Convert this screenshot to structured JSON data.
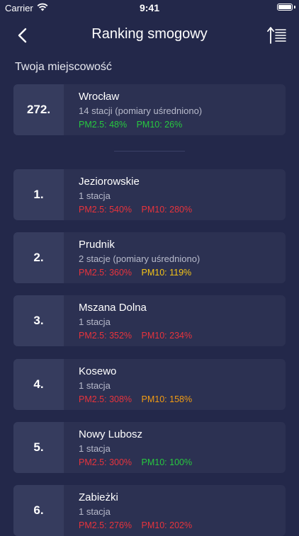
{
  "status": {
    "carrier": "Carrier",
    "time": "9:41"
  },
  "nav": {
    "title": "Ranking smogowy"
  },
  "section_title": "Twoja miejscowość",
  "colors": {
    "green": "#27c93f",
    "yellow": "#f5c518",
    "orange": "#f39c12",
    "red": "#e8333c",
    "background": "#23284a"
  },
  "my_city": {
    "rank": "272.",
    "name": "Wrocław",
    "stations": "14 stacji (pomiary uśredniono)",
    "pm25": "PM2.5: 48%",
    "pm25_color": "#27c93f",
    "pm10": "PM10: 26%",
    "pm10_color": "#27c93f"
  },
  "ranking": [
    {
      "rank": "1.",
      "name": "Jeziorowskie",
      "stations": "1 stacja",
      "pm25": "PM2.5: 540%",
      "pm25_color": "#e8333c",
      "pm10": "PM10: 280%",
      "pm10_color": "#e8333c"
    },
    {
      "rank": "2.",
      "name": "Prudnik",
      "stations": "2 stacje (pomiary uśredniono)",
      "pm25": "PM2.5: 360%",
      "pm25_color": "#e8333c",
      "pm10": "PM10: 119%",
      "pm10_color": "#f5c518"
    },
    {
      "rank": "3.",
      "name": "Mszana Dolna",
      "stations": "1 stacja",
      "pm25": "PM2.5: 352%",
      "pm25_color": "#e8333c",
      "pm10": "PM10: 234%",
      "pm10_color": "#e8333c"
    },
    {
      "rank": "4.",
      "name": "Kosewo",
      "stations": "1 stacja",
      "pm25": "PM2.5: 308%",
      "pm25_color": "#e8333c",
      "pm10": "PM10: 158%",
      "pm10_color": "#f39c12"
    },
    {
      "rank": "5.",
      "name": "Nowy Lubosz",
      "stations": "1 stacja",
      "pm25": "PM2.5: 300%",
      "pm25_color": "#e8333c",
      "pm10": "PM10: 100%",
      "pm10_color": "#27c93f"
    },
    {
      "rank": "6.",
      "name": "Zabieżki",
      "stations": "1 stacja",
      "pm25": "PM2.5: 276%",
      "pm25_color": "#e8333c",
      "pm10": "PM10: 202%",
      "pm10_color": "#e8333c"
    }
  ]
}
